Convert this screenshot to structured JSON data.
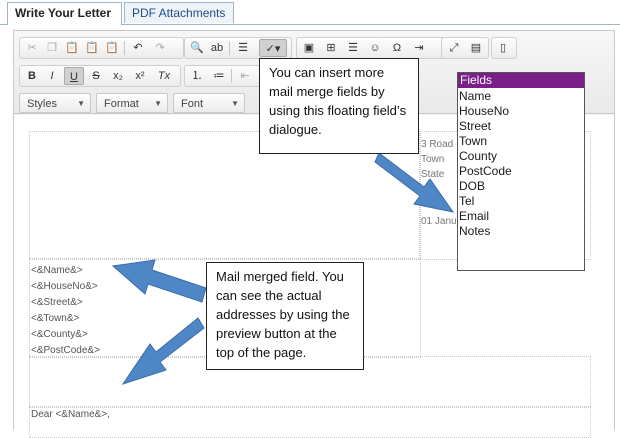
{
  "tabs": [
    {
      "label": "Write Your Letter"
    },
    {
      "label": "PDF Attachments"
    }
  ],
  "toolbar": {
    "icons_row1": [
      "cut-icon",
      "copy-icon",
      "paste-icon",
      "paste-text-icon",
      "paste-word-icon",
      "undo-icon",
      "redo-icon",
      "find-icon",
      "replace-icon",
      "select-all-icon",
      "spellcheck-icon",
      "image-icon",
      "table-icon",
      "horizontal-line-icon",
      "smiley-icon",
      "special-char-icon",
      "page-break-icon",
      "maximize-icon",
      "show-blocks-icon",
      "source-icon"
    ],
    "icons_row2": [
      "bold-icon",
      "italic-icon",
      "underline-icon",
      "strike-icon",
      "subscript-icon",
      "superscript-icon",
      "remove-format-icon",
      "numbered-list-icon",
      "bulleted-list-icon",
      "outdent-icon"
    ],
    "styles_label": "Styles",
    "format_label": "Format",
    "font_label": "Font"
  },
  "letter": {
    "address_lines": [
      "3 Road",
      "Town",
      "State"
    ],
    "date_partial": "01 Janua",
    "merge_fields": [
      "<&Name&>",
      "<&HouseNo&>",
      "<&Street&>",
      "<&Town&>",
      "<&County&>",
      "<&PostCode&>"
    ],
    "salutation": "Dear <&Name&>,"
  },
  "fields_popup": {
    "header": "Fields",
    "items": [
      "Name",
      "HouseNo",
      "Street",
      "Town",
      "County",
      "PostCode",
      "DOB",
      "Tel",
      "Email",
      "Notes"
    ],
    "header_color": "#7a1f87"
  },
  "callouts": {
    "top": "You can insert more mail merge fields by using this floating field’s dialogue.",
    "bottom": "Mail merged field. You can see the actual addresses by using the preview button at the top of the page."
  },
  "colors": {
    "arrow": "#4f86c6",
    "arrow_border": "#3a6ea8"
  }
}
